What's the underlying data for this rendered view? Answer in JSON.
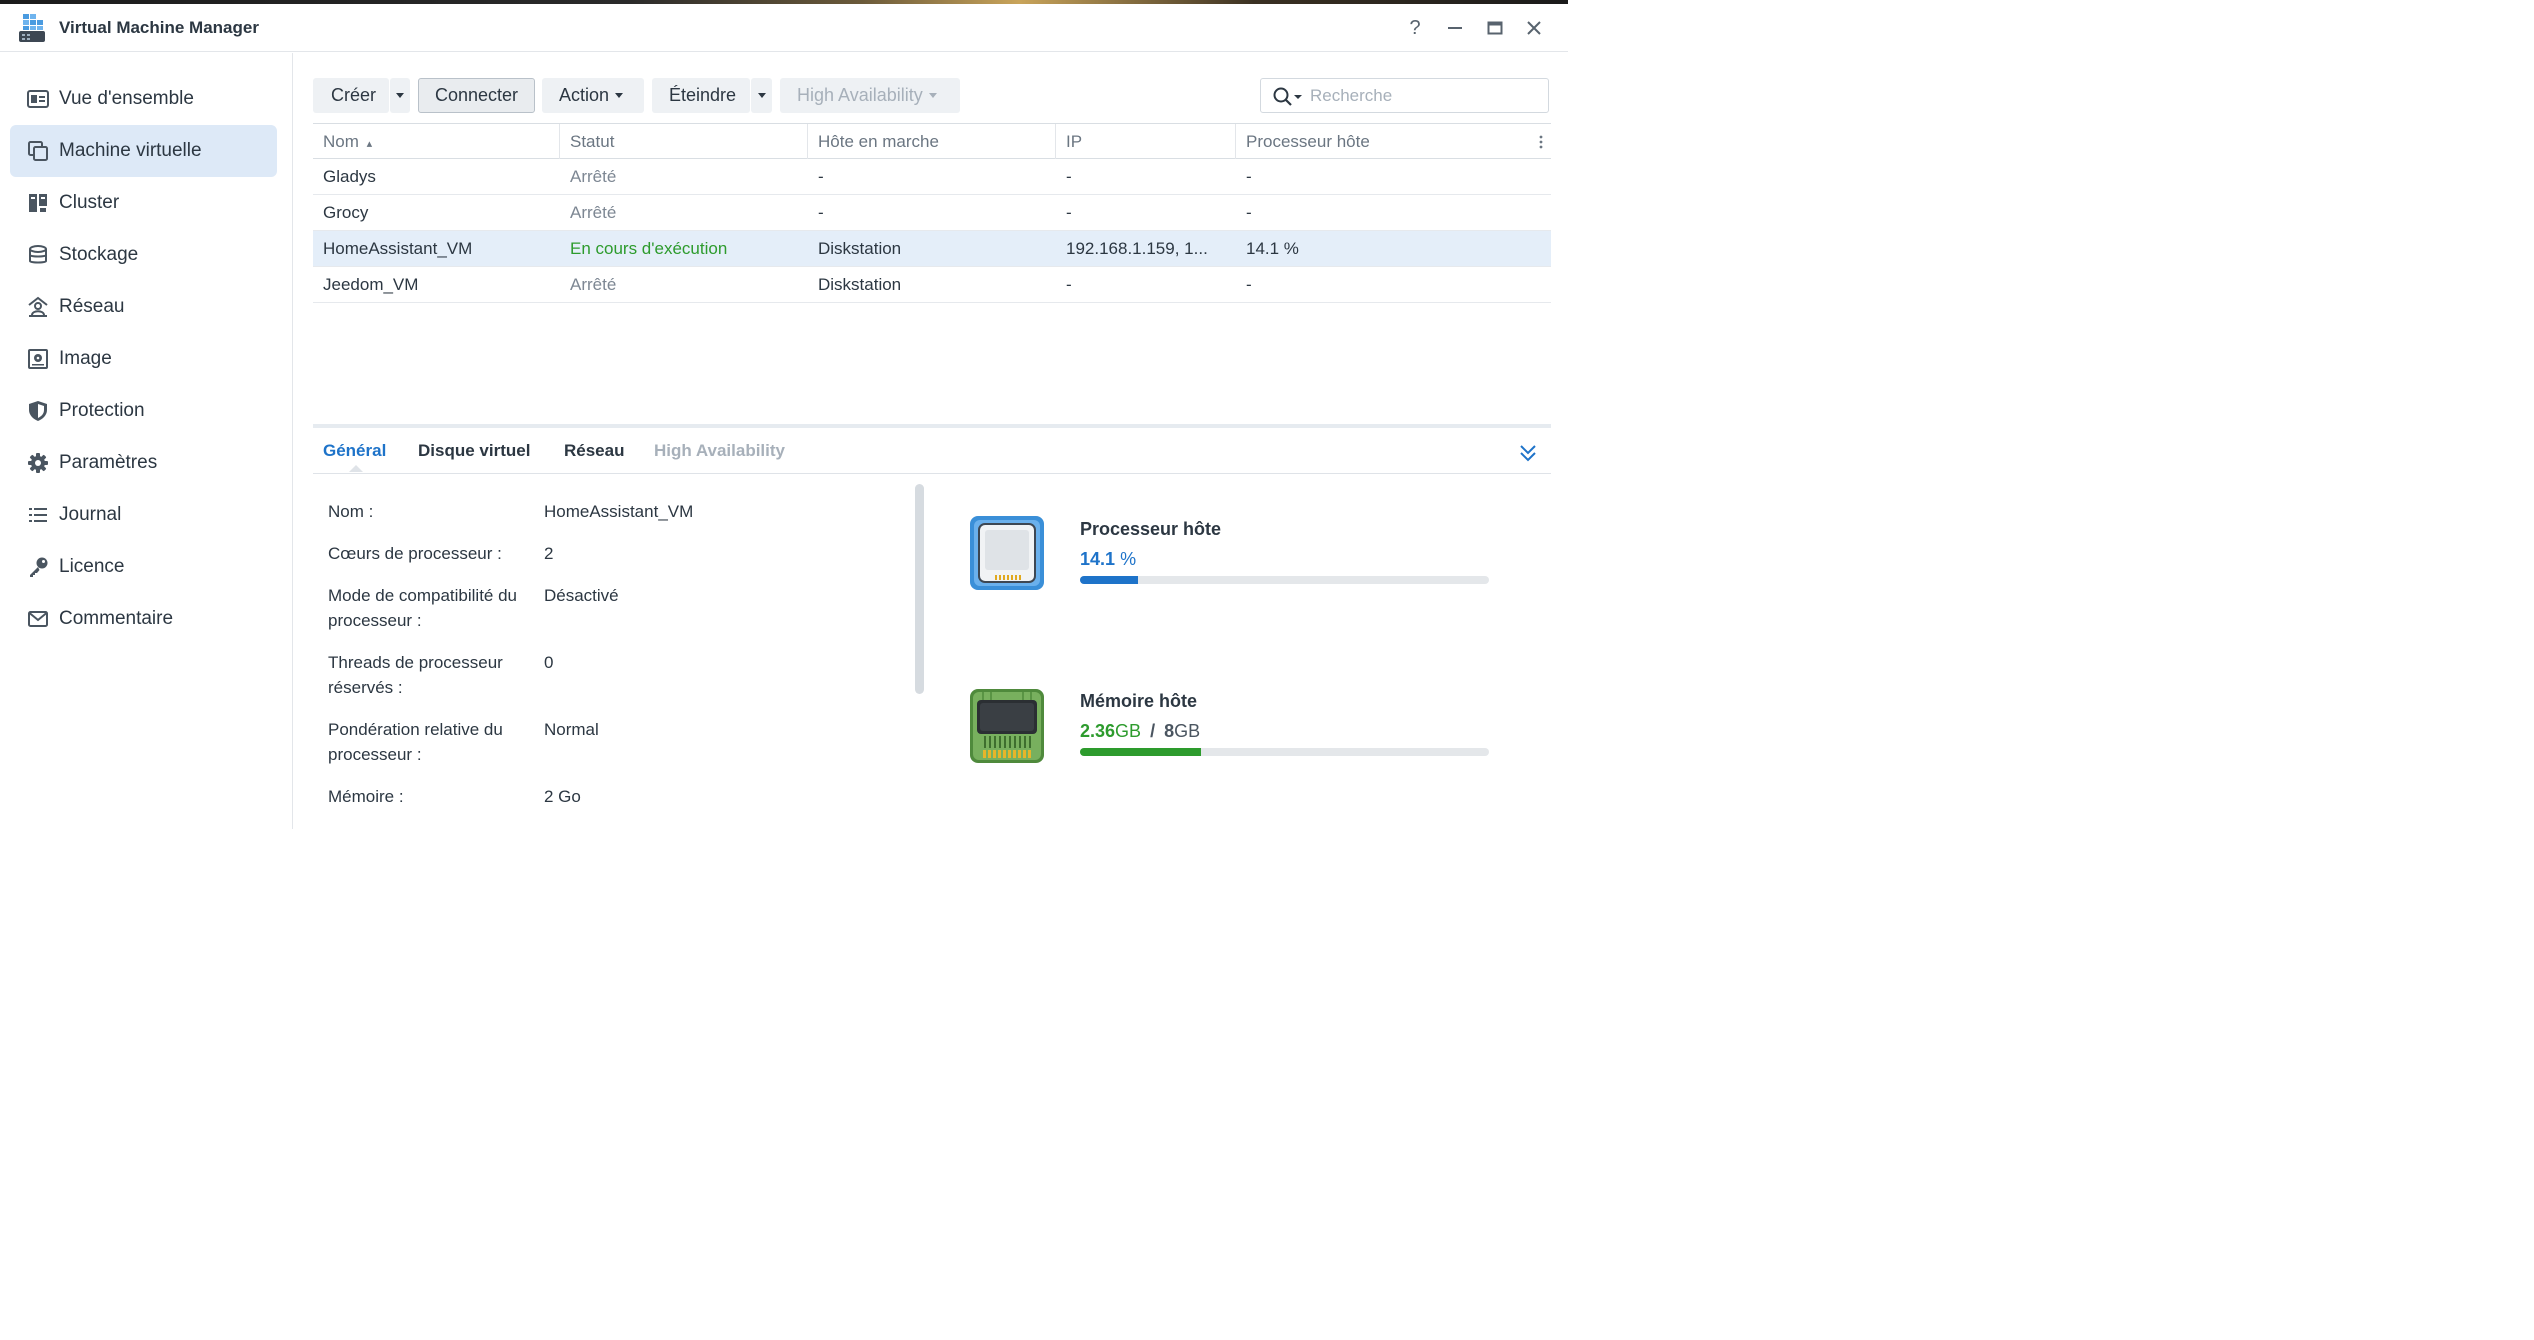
{
  "window": {
    "title": "Virtual Machine Manager",
    "help_symbol": "?",
    "minimize_symbol": "—",
    "close_symbol": "✕"
  },
  "sidebar": {
    "items": [
      {
        "label": "Vue d'ensemble",
        "icon": "overview-icon"
      },
      {
        "label": "Machine virtuelle",
        "icon": "virtual-machine-icon",
        "active": true
      },
      {
        "label": "Cluster",
        "icon": "cluster-icon"
      },
      {
        "label": "Stockage",
        "icon": "storage-icon"
      },
      {
        "label": "Réseau",
        "icon": "network-icon"
      },
      {
        "label": "Image",
        "icon": "image-icon"
      },
      {
        "label": "Protection",
        "icon": "shield-icon"
      },
      {
        "label": "Paramètres",
        "icon": "gear-icon"
      },
      {
        "label": "Journal",
        "icon": "list-icon"
      },
      {
        "label": "Licence",
        "icon": "key-icon"
      },
      {
        "label": "Commentaire",
        "icon": "mail-icon"
      }
    ]
  },
  "toolbar": {
    "create_label": "Créer",
    "connect_label": "Connecter",
    "action_label": "Action",
    "shutdown_label": "Éteindre",
    "ha_label": "High Availability",
    "search_placeholder": "Recherche"
  },
  "grid": {
    "columns": [
      "Nom",
      "Statut",
      "Hôte en marche",
      "IP",
      "Processeur hôte"
    ],
    "sort_indicator": "▴",
    "rows": [
      {
        "name": "Gladys",
        "status": "Arrêté",
        "host": "-",
        "ip": "-",
        "cpu": "-"
      },
      {
        "name": "Grocy",
        "status": "Arrêté",
        "host": "-",
        "ip": "-",
        "cpu": "-"
      },
      {
        "name": "HomeAssistant_VM",
        "status": "En cours d'exécution",
        "host": "Diskstation",
        "ip": "192.168.1.159, 1...",
        "cpu": "14.1 %",
        "selected": true
      },
      {
        "name": "Jeedom_VM",
        "status": "Arrêté",
        "host": "Diskstation",
        "ip": "-",
        "cpu": "-"
      }
    ]
  },
  "detail": {
    "tabs": [
      {
        "label": "Général",
        "state": "active"
      },
      {
        "label": "Disque virtuel",
        "state": "normal"
      },
      {
        "label": "Réseau",
        "state": "normal"
      },
      {
        "label": "High Availability",
        "state": "disabled"
      }
    ],
    "fields": [
      {
        "label": "Nom :",
        "value": "HomeAssistant_VM"
      },
      {
        "label": "Cœurs de processeur :",
        "value": "2"
      },
      {
        "label_line1": "Mode de compatibilité du",
        "label_line2": "processeur :",
        "value": "Désactivé"
      },
      {
        "label_line1": "Threads de processeur",
        "label_line2": "réservés :",
        "value": "0"
      },
      {
        "label_line1": "Pondération relative du",
        "label_line2": "processeur :",
        "value": "Normal"
      },
      {
        "label": "Mémoire :",
        "value": "2 Go"
      }
    ],
    "cpu": {
      "title": "Processeur hôte",
      "value": "14.1",
      "unit": "%",
      "fraction": 0.141,
      "color": "#1e73c9"
    },
    "memory": {
      "title": "Mémoire hôte",
      "used": "2.36",
      "used_unit": "GB",
      "separator": "/",
      "total": "8",
      "total_unit": "GB",
      "fraction": 0.295,
      "color": "#2d9b2d"
    }
  }
}
